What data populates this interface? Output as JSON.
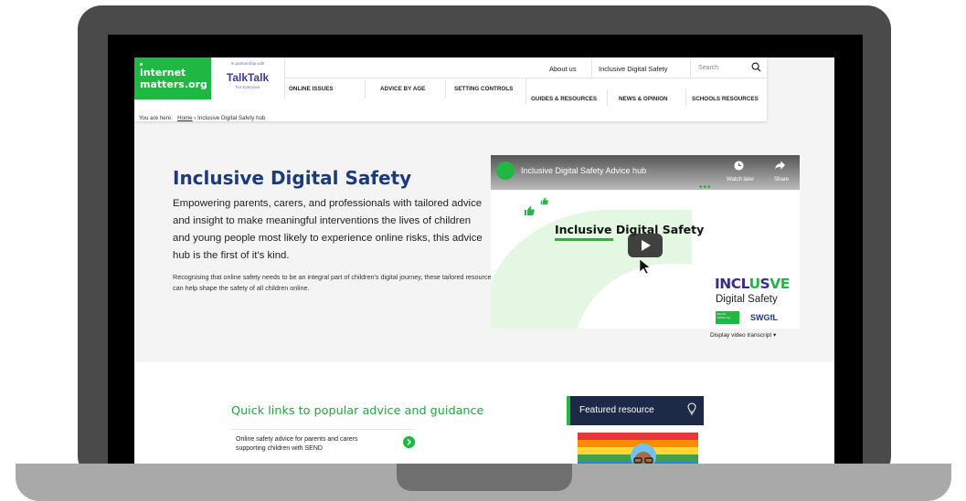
{
  "site": {
    "logo_line1": "internet",
    "logo_line2": "matters.org",
    "partner_label": "In partnership with",
    "partner_name": "TalkTalk",
    "partner_tagline": "For Everyone",
    "brand_green": "#1fb843",
    "brand_navy": "#1f3a7a"
  },
  "header": {
    "top_links": [
      "About us",
      "Inclusive Digital Safety"
    ],
    "search_placeholder": "Search",
    "nav_row1": [
      "ONLINE ISSUES",
      "ADVICE BY AGE",
      "SETTING CONTROLS"
    ],
    "nav_row2": [
      "GUIDES & RESOURCES",
      "NEWS & OPINION",
      "SCHOOLS RESOURCES"
    ]
  },
  "breadcrumb": {
    "prefix": "You are here:",
    "home": "Home",
    "separator": "›",
    "current": "Inclusive Digital Safety hub"
  },
  "hero": {
    "title": "Inclusive Digital Safety",
    "lead": "Empowering parents, carers, and professionals with tailored advice and insight to make meaningful interventions the lives of children and young people most likely to experience online risks, this advice hub is the first of it's kind.",
    "body": "Recognising that online safety needs to be an integral part of children's digital journey, these tailored resources can help shape the safety of all children online."
  },
  "video": {
    "title": "Inclusive Digital Safety Advice hub",
    "watch_later": "Watch later",
    "share": "Share",
    "card_text": "Inclusive Digital Safety",
    "logo_word_part1": "INCL",
    "logo_word_part2": "U",
    "logo_word_part3": "S",
    "logo_word_part4": "VE",
    "logo_sub": "Digital Safety",
    "mini_logo": "Internet matters.org",
    "swgfl": "SWGfL",
    "transcript": "Display video transcript ▾"
  },
  "quick_links": {
    "title": "Quick links to popular advice and guidance",
    "items": [
      "Online safety advice for parents and carers supporting children with SEND"
    ]
  },
  "featured": {
    "label": "Featured resource"
  }
}
